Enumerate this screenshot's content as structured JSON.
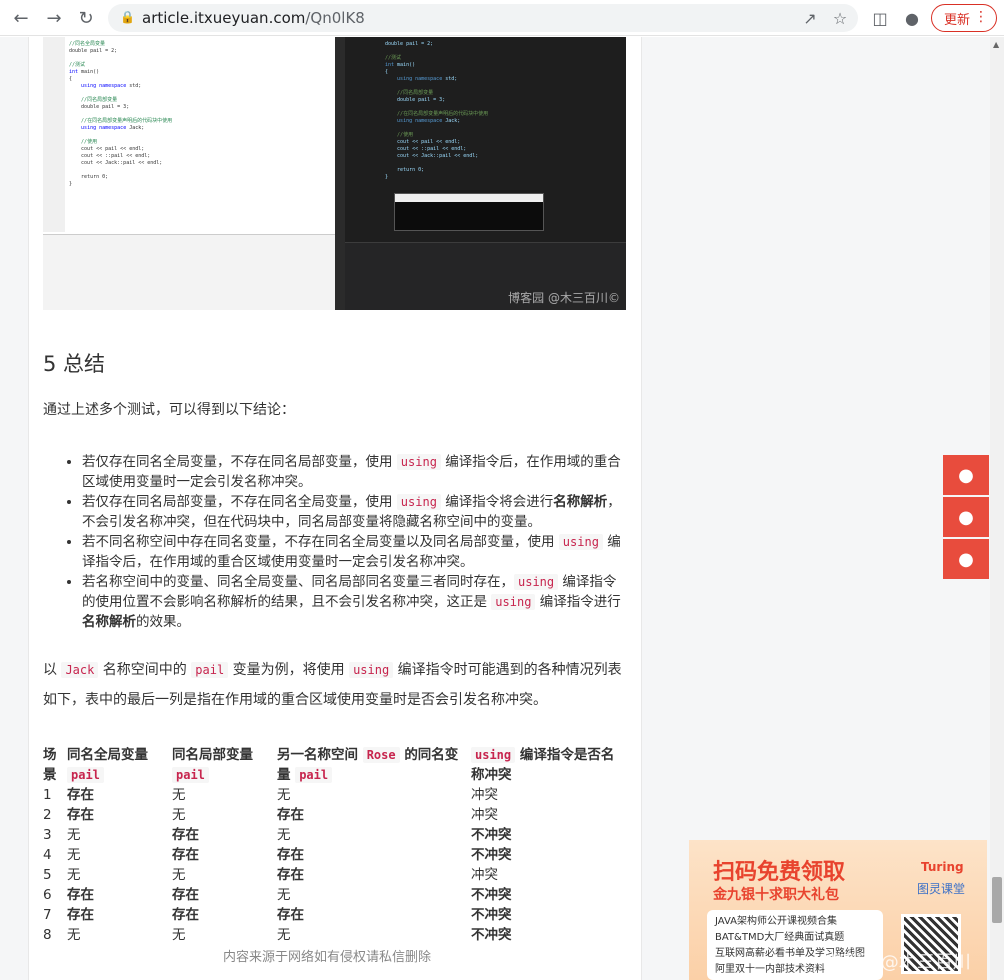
{
  "browser": {
    "url_host": "article.itxueyuan.com",
    "url_path": "/Qn0lK8",
    "update_label": "更新",
    "menu_dots": "⋮"
  },
  "article": {
    "screenshot_watermark": "博客园 @木三百川©",
    "section_title": "5 总结",
    "intro": "通过上述多个测试，可以得到以下结论：",
    "bullets": [
      {
        "parts": [
          "若仅存在同名全局变量，不存在同名局部变量，使用 ",
          "using",
          " 编译指令后，在作用域的重合区域使用变量时一定会引发名称冲突。"
        ]
      },
      {
        "parts": [
          "若仅存在同名局部变量，不存在同名全局变量，使用 ",
          "using",
          " 编译指令将会进行",
          "名称解析",
          "，不会引发名称冲突，但在代码块中，同名局部变量将隐藏名称空间中的变量。"
        ]
      },
      {
        "parts": [
          "若不同名称空间中存在同名变量，不存在同名全局变量以及同名局部变量，使用 ",
          "using",
          " 编译指令后，在作用域的重合区域使用变量时一定会引发名称冲突。"
        ]
      },
      {
        "parts": [
          "若名称空间中的变量、同名全局变量、同名局部同名变量三者同时存在，",
          "using",
          " 编译指令的使用位置不会影响名称解析的结果，且不会引发名称冲突，这正是 ",
          "using",
          " 编译指令进行",
          "名称解析",
          "的效果。"
        ]
      }
    ],
    "example_line1": {
      "a": "以 ",
      "code1": "Jack",
      "b": " 名称空间中的 ",
      "code2": "pail",
      "c": " 变量为例，将使用 ",
      "code3": "using",
      "d": " 编译指令时可能遇到的各种情况列表"
    },
    "example_line2": "如下，表中的最后一列是指在作用域的重合区域使用变量时是否会引发名称冲突。",
    "table": {
      "headers": {
        "col1_a": "场",
        "col1_b": "景",
        "col2_text": "同名全局变量",
        "col2_code": "pail",
        "col3_text": "同名局部变量",
        "col3_code": "pail",
        "col4_text": "另一名称空间",
        "col4_code1": "Rose",
        "col4_text2": "的同名变",
        "col4_text3": "量",
        "col4_code2": "pail",
        "col5_code": "using",
        "col5_text": "编译指令是否名",
        "col5_text2": "称冲突"
      },
      "rows": [
        {
          "id": "1",
          "global": "存在",
          "global_bold": true,
          "local": "无",
          "local_bold": false,
          "other": "无",
          "other_bold": false,
          "conflict": "冲突",
          "conflict_bold": false
        },
        {
          "id": "2",
          "global": "存在",
          "global_bold": true,
          "local": "无",
          "local_bold": false,
          "other": "存在",
          "other_bold": true,
          "conflict": "冲突",
          "conflict_bold": false
        },
        {
          "id": "3",
          "global": "无",
          "global_bold": false,
          "local": "存在",
          "local_bold": true,
          "other": "无",
          "other_bold": false,
          "conflict": "不冲突",
          "conflict_bold": true
        },
        {
          "id": "4",
          "global": "无",
          "global_bold": false,
          "local": "存在",
          "local_bold": true,
          "other": "存在",
          "other_bold": true,
          "conflict": "不冲突",
          "conflict_bold": true
        },
        {
          "id": "5",
          "global": "无",
          "global_bold": false,
          "local": "无",
          "local_bold": false,
          "other": "存在",
          "other_bold": true,
          "conflict": "冲突",
          "conflict_bold": false
        },
        {
          "id": "6",
          "global": "存在",
          "global_bold": true,
          "local": "存在",
          "local_bold": true,
          "other": "无",
          "other_bold": false,
          "conflict": "不冲突",
          "conflict_bold": true
        },
        {
          "id": "7",
          "global": "存在",
          "global_bold": true,
          "local": "存在",
          "local_bold": true,
          "other": "存在",
          "other_bold": true,
          "conflict": "不冲突",
          "conflict_bold": true
        },
        {
          "id": "8",
          "global": "无",
          "global_bold": false,
          "local": "无",
          "local_bold": false,
          "other": "无",
          "other_bold": false,
          "conflict": "不冲突",
          "conflict_bold": true
        }
      ]
    },
    "footer_note": "内容来源于网络如有侵权请私信删除"
  },
  "ad": {
    "headline": "扫码免费领取",
    "subhead": "金九银十求职大礼包",
    "brand": "Turing",
    "brand_sub": "图灵课堂",
    "items": [
      "JAVA架构师公开课视频合集",
      "BAT&TMD大厂经典面试真题",
      "互联网高薪必看书单及学习路线图",
      "阿里双十一内部技术资料"
    ],
    "watermark": "博客园 @木三百川©"
  },
  "floating_buttons": [
    "qq-icon",
    "share-icon",
    "wechat-icon"
  ],
  "colors": {
    "accent": "#e84c3d",
    "code_text": "#c7254e"
  }
}
